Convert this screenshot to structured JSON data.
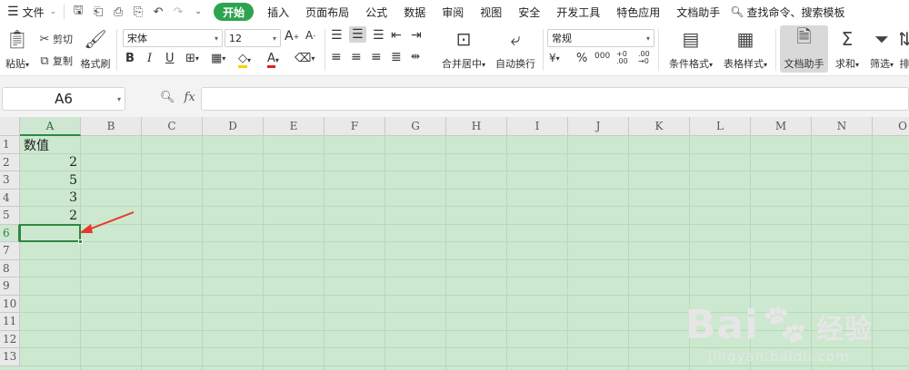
{
  "menubar": {
    "hamburger_label": "文件",
    "tabs": [
      "开始",
      "插入",
      "页面布局",
      "公式",
      "数据",
      "审阅",
      "视图",
      "安全",
      "开发工具",
      "特色应用",
      "文档助手"
    ],
    "active_tab": "开始",
    "search_placeholder": "查找命令、搜索模板"
  },
  "ribbon": {
    "paste": "粘贴",
    "cut": "剪切",
    "copy": "复制",
    "format_painter": "格式刷",
    "font_name": "宋体",
    "font_size": "12",
    "merge_center": "合并居中",
    "wrap_text": "自动换行",
    "number_format": "常规",
    "conditional_format": "条件格式",
    "table_style": "表格样式",
    "doc_assistant": "文档助手",
    "sum": "求和",
    "filter": "筛选",
    "sort": "排"
  },
  "formula_bar": {
    "name_box": "A6",
    "fx": "fx",
    "content": ""
  },
  "sheet": {
    "columns": [
      "A",
      "B",
      "C",
      "D",
      "E",
      "F",
      "G",
      "H",
      "I",
      "J",
      "K",
      "L",
      "M",
      "N",
      "O"
    ],
    "rows": [
      "1",
      "2",
      "3",
      "4",
      "5",
      "6",
      "7",
      "8",
      "9",
      "10",
      "11",
      "12",
      "13"
    ],
    "selected_cell": "A6",
    "cells": {
      "A1": "数值",
      "A2": "2",
      "A3": "5",
      "A4": "3",
      "A5": "2"
    }
  },
  "colors": {
    "sheet_bg": "#cce8cf",
    "accent": "#2b8a3e",
    "annotation_arrow": "#e8382b"
  },
  "watermark": {
    "brand": "Bai",
    "brand_cn": "经验",
    "url": "jingyan.baidu.com"
  }
}
